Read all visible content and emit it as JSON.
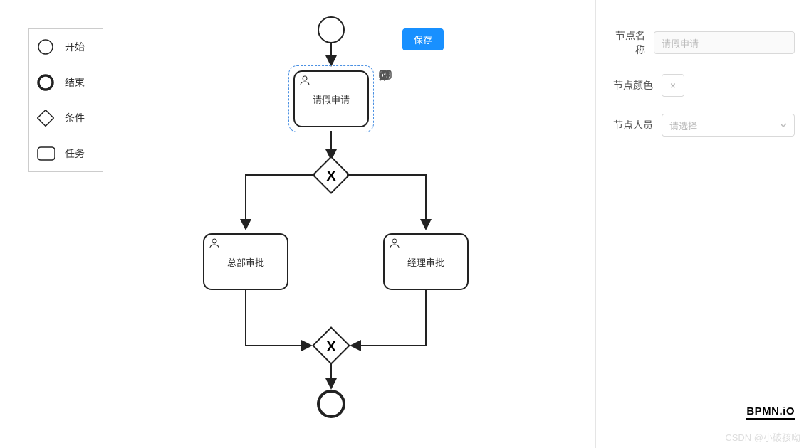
{
  "palette": {
    "items": [
      {
        "label": "开始",
        "name": "palette-start"
      },
      {
        "label": "结束",
        "name": "palette-end"
      },
      {
        "label": "条件",
        "name": "palette-gateway"
      },
      {
        "label": "任务",
        "name": "palette-task"
      }
    ]
  },
  "buttons": {
    "save": "保存"
  },
  "panel": {
    "name_label": "节点名称",
    "name_value": "请假申请",
    "color_label": "节点颜色",
    "color_clear_icon": "×",
    "person_label": "节点人员",
    "person_placeholder": "请选择"
  },
  "canvas": {
    "selected_task_label": "请假申请",
    "task_hq_label": "总部审批",
    "task_manager_label": "经理审批"
  },
  "context_pad": {
    "tools": [
      "start-event-icon",
      "gateway-icon",
      "task-icon",
      "end-event-icon",
      "intermediate-event-icon",
      "subprocess-icon",
      "wrench-icon",
      "trash-icon",
      "connect-icon"
    ]
  },
  "logo": "BPMN.iO",
  "watermark": "CSDN @小破孩呦"
}
